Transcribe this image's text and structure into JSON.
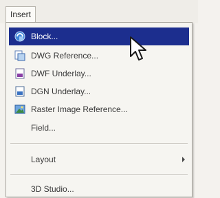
{
  "menu": {
    "title": "Insert",
    "items": [
      {
        "label": "Block...",
        "icon": "block-icon",
        "selected": true
      },
      {
        "label": "DWG Reference...",
        "icon": "dwg-reference-icon"
      },
      {
        "label": "DWF Underlay...",
        "icon": "dwf-underlay-icon"
      },
      {
        "label": "DGN Underlay...",
        "icon": "dgn-underlay-icon"
      },
      {
        "label": "Raster Image Reference...",
        "icon": "raster-image-icon"
      },
      {
        "label": "Field..."
      },
      {
        "label": "Layout",
        "submenu": true
      },
      {
        "label": "3D Studio..."
      }
    ]
  },
  "colors": {
    "highlight": "#1c2e8e",
    "menu_background": "#f6f5f1",
    "text": "#3a3a3a"
  }
}
